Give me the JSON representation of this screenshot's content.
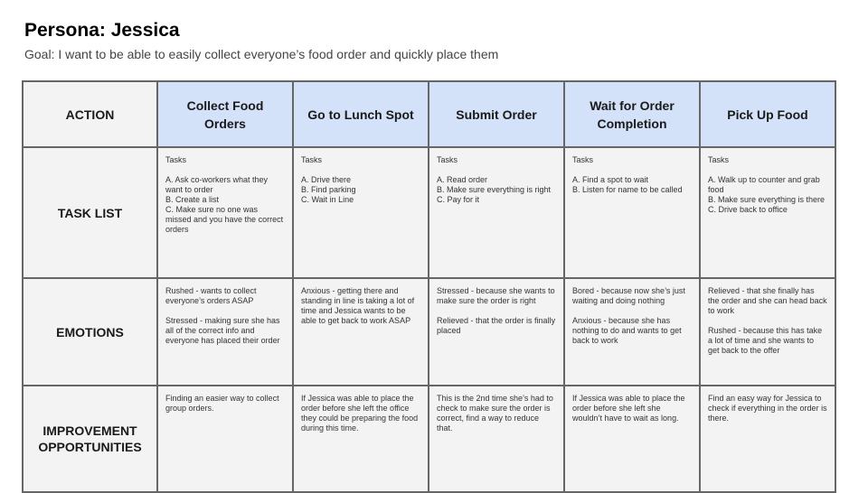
{
  "title": "Persona: Jessica",
  "goal": "Goal: I want to be able to easily collect everyone’s food order and quickly place them",
  "corner_label": "ACTION",
  "stages": [
    "Collect Food Orders",
    "Go to Lunch Spot",
    "Submit Order",
    "Wait for Order Completion",
    "Pick Up Food"
  ],
  "rows": [
    {
      "label": "TASK LIST",
      "cells": [
        "Tasks\n\nA. Ask co-workers what they want to order\nB. Create a list\nC. Make sure no one was missed and you have the correct orders",
        "Tasks\n\nA. Drive there\nB. Find parking\nC. Wait in Line",
        "Tasks\n\nA. Read order\nB. Make sure everything is right\nC. Pay for it",
        "Tasks\n\nA. Find a spot to wait\nB. Listen for name to be called",
        "Tasks\n\nA. Walk up to counter and grab food\nB. Make sure everything is there\nC. Drive back to office"
      ]
    },
    {
      "label": "EMOTIONS",
      "cells": [
        "Rushed - wants to collect everyone’s orders ASAP\n\nStressed - making sure she has all of the correct info and everyone has placed their order",
        "Anxious - getting there and standing in line is taking a lot of time and Jessica wants to be able to get back to work ASAP",
        "Stressed - because she wants to make sure the order is right\n\nRelieved - that the order is finally placed",
        "Bored - because now she’s just waiting and doing nothing\n\nAnxious - because she has nothing to do and wants to get back to work",
        "Relieved - that she finally has the order and she can head back to work\n\nRushed - because this has take a lot of time and she wants to get back to the offer"
      ]
    },
    {
      "label": "IMPROVEMENT OPPORTUNITIES",
      "cells": [
        "Finding an easier way to collect group orders.",
        "If Jessica was able to place the order before she left the office they could be preparing the food during this time.",
        "This is the 2nd time she’s had to check to make sure the order is correct, find a way to reduce that.",
        "If Jessica was able to place the order before she left she wouldn’t have to wait as long.",
        "Find an easy way for Jessica to check if everything in the order is there."
      ]
    }
  ]
}
